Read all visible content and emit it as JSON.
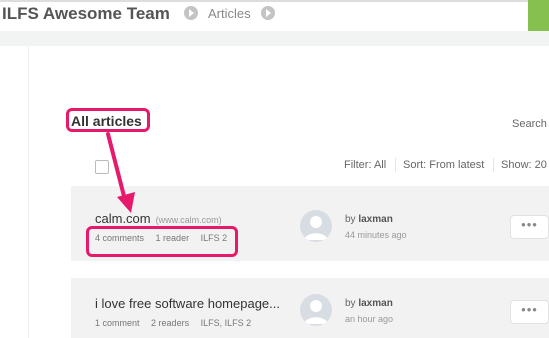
{
  "header": {
    "team_name": "ILFS Awesome Team",
    "breadcrumb": "Articles"
  },
  "main": {
    "section_title": "All articles",
    "search_label": "Search",
    "toolbar": {
      "filter": "Filter: All",
      "sort": "Sort: From latest",
      "show": "Show: 20"
    },
    "articles": [
      {
        "title": "calm.com",
        "url": "(www.calm.com)",
        "comments": "4 comments",
        "readers": "1 reader",
        "groups": "ILFS 2",
        "by_prefix": "by",
        "author": "laxman",
        "time": "44 minutes ago",
        "more_label": "•••"
      },
      {
        "title": "i love free software homepage...",
        "url": "",
        "comments": "1 comment",
        "readers": "2 readers",
        "groups": "ILFS, ILFS 2",
        "by_prefix": "by",
        "author": "laxman",
        "time": "an hour ago",
        "more_label": "•••"
      }
    ]
  },
  "colors": {
    "highlight": "#e6196b",
    "accent_green": "#86c04e",
    "row_background": "#f2f2f2"
  },
  "icons": [
    "chevron-right-icon",
    "avatar-placeholder-icon",
    "more-dots-icon",
    "annotation-arrow"
  ]
}
